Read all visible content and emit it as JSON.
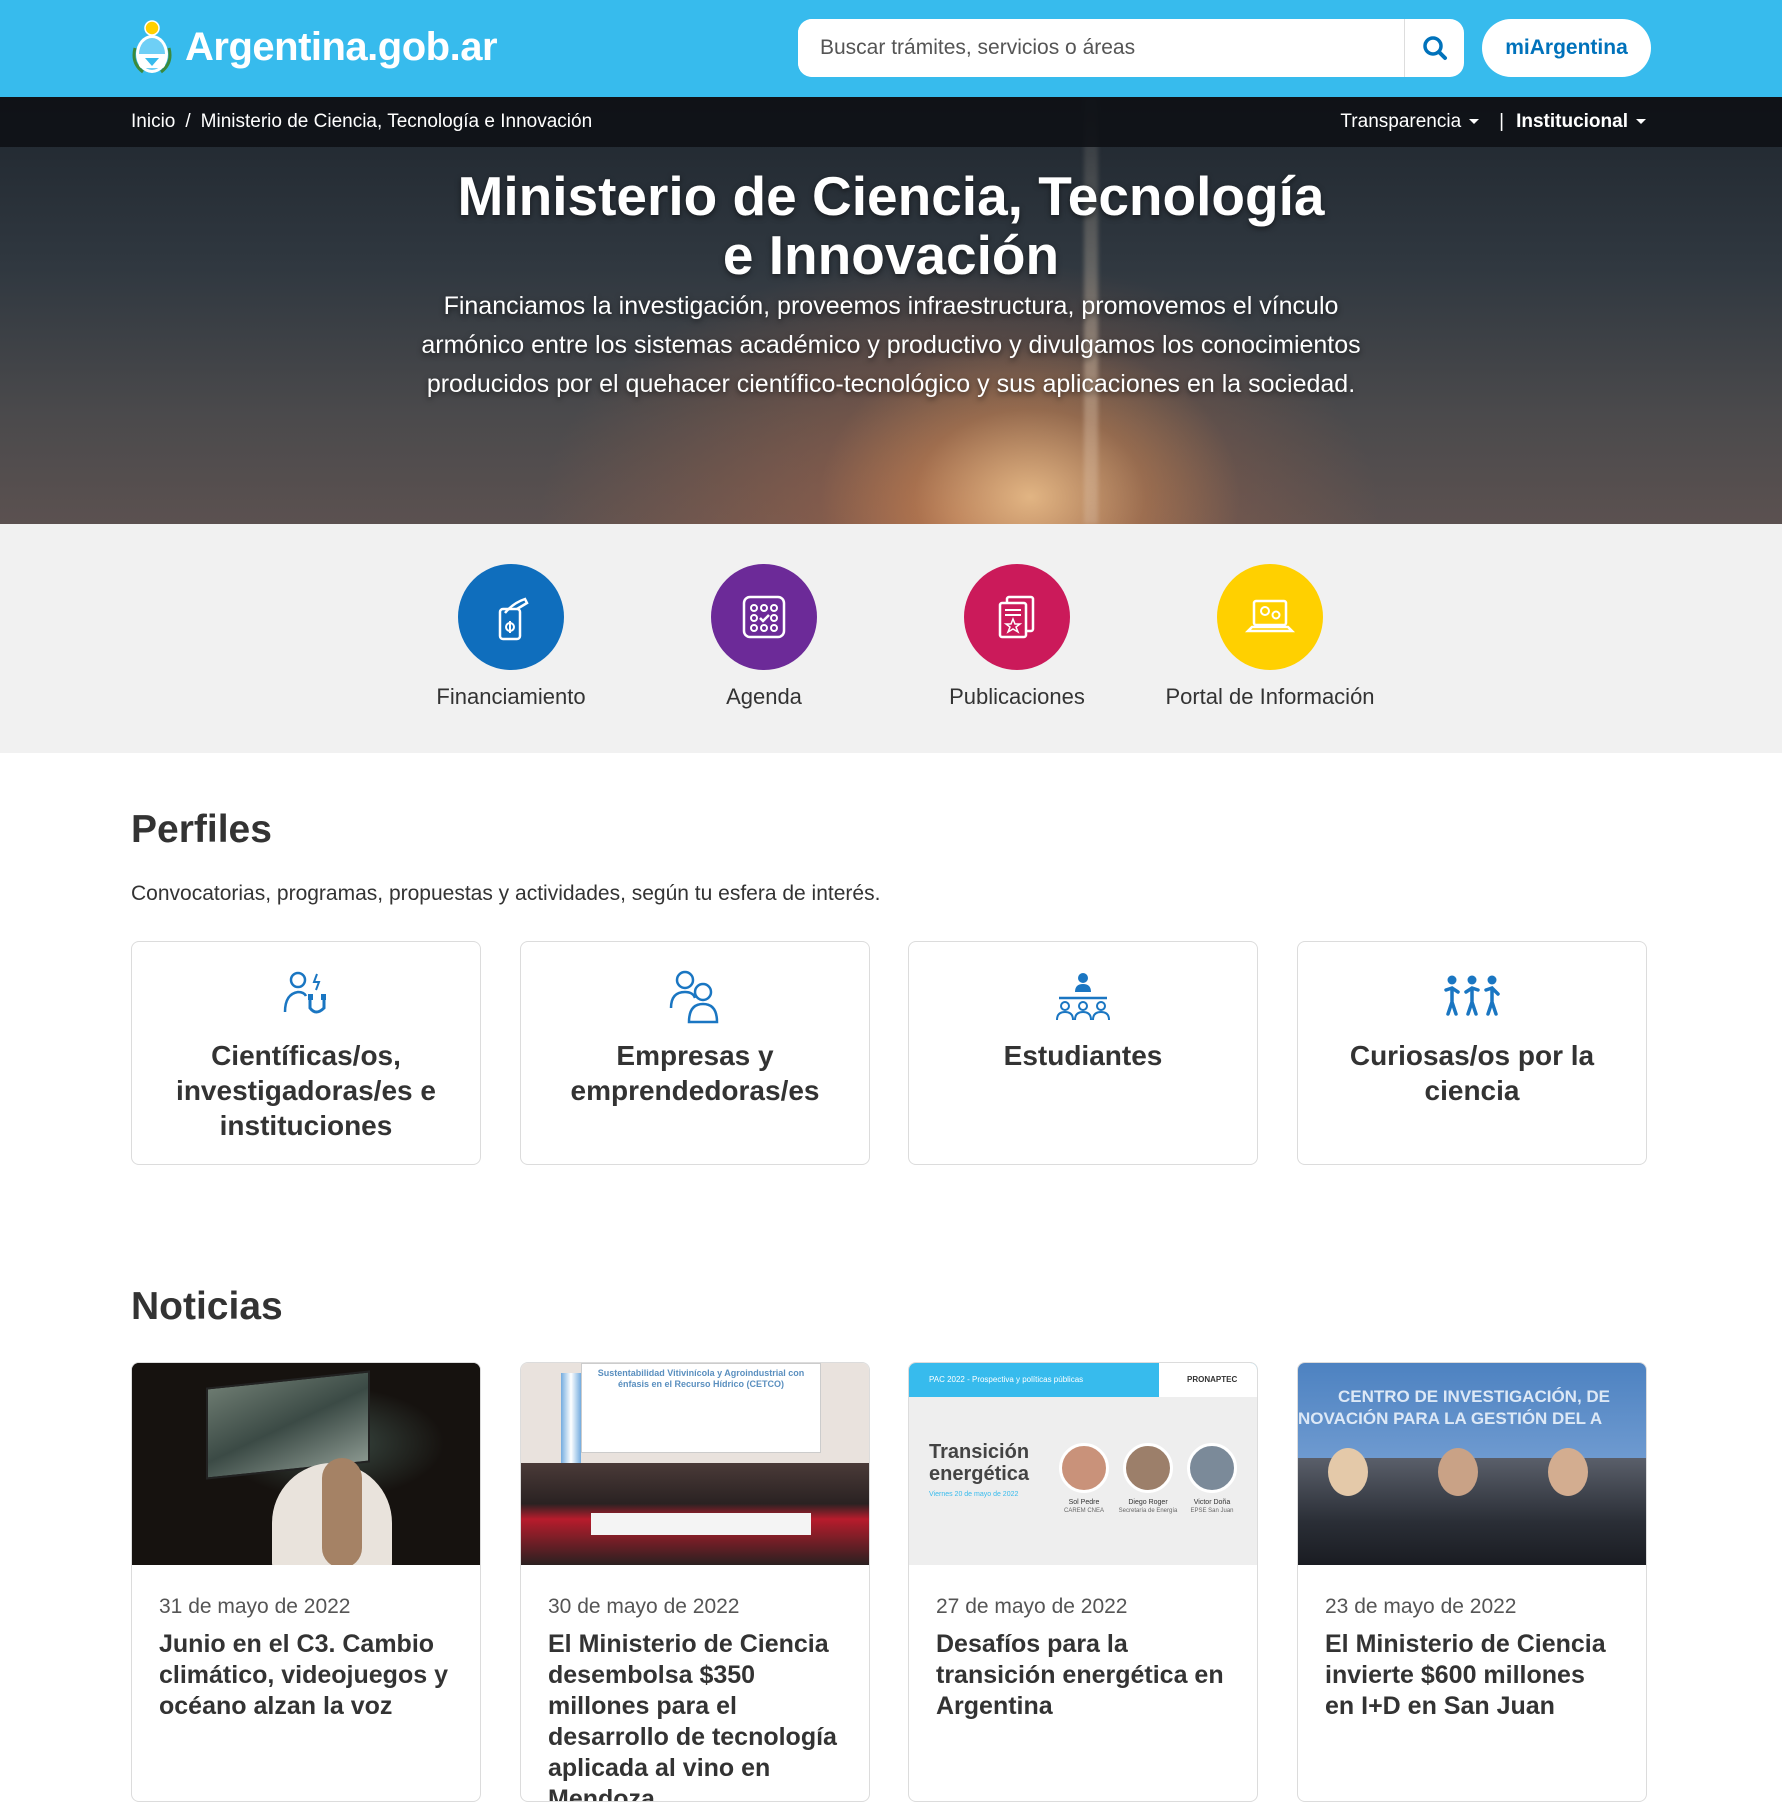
{
  "header": {
    "site_name": "Argentina.gob.ar",
    "search_placeholder": "Buscar trámites, servicios o áreas",
    "account_button": "miArgentina",
    "brand_color": "#37bbed",
    "account_color": "#0072bb"
  },
  "breadcrumb": {
    "home": "Inicio",
    "separator": "/",
    "current": "Ministerio de Ciencia, Tecnología e Innovación"
  },
  "top_nav": {
    "items": [
      {
        "label": "Transparencia"
      },
      {
        "label": "Institucional"
      }
    ],
    "divider": "|"
  },
  "hero": {
    "title": "Ministerio de Ciencia, Tecnología e Innovación",
    "subtitle": "Financiamos la investigación, proveemos infraestructura, promovemos el vínculo armónico entre los sistemas académico y productivo y divulgamos los conocimientos producidos por el quehacer científico-tecnológico y sus aplicaciones en la sociedad."
  },
  "quick_links": [
    {
      "label": "Financiamiento",
      "icon": "hand-phone-icon",
      "color": "#0f6ebd"
    },
    {
      "label": "Agenda",
      "icon": "calendar-grid-icon",
      "color": "#6c2a98"
    },
    {
      "label": "Publicaciones",
      "icon": "documents-icon",
      "color": "#cb1a5a"
    },
    {
      "label": "Portal de Información",
      "icon": "laptop-gears-icon",
      "color": "#ffd000"
    }
  ],
  "perfiles": {
    "title": "Perfiles",
    "lead": "Convocatorias, programas, propuestas y actividades, según tu esfera de interés.",
    "cards": [
      {
        "title": "Científicas/os, investigadoras/es e instituciones",
        "icon": "researcher-magnet-icon"
      },
      {
        "title": "Empresas y emprendedoras/es",
        "icon": "two-people-icon"
      },
      {
        "title": "Estudiantes",
        "icon": "classroom-icon"
      },
      {
        "title": "Curiosas/os por la ciencia",
        "icon": "three-people-icon"
      }
    ],
    "icon_color": "#1a76c2"
  },
  "noticias": {
    "title": "Noticias",
    "items": [
      {
        "date": "31 de mayo de 2022",
        "title": "Junio en el C3. Cambio climático, videojuegos y océano alzan la voz"
      },
      {
        "date": "30 de mayo de 2022",
        "title": "El Ministerio de Ciencia desembolsa $350 millones para el desarrollo de tecnología aplicada al vino en Mendoza",
        "image_text": {
          "banner": "Sustentabilidad Vitivinícola y Agroindustrial con énfasis en el Recurso Hídrico (CETCO)"
        }
      },
      {
        "date": "27 de mayo de 2022",
        "title": "Desafíos para la transición energética en Argentina",
        "image_text": {
          "header": "PAC 2022 - Prospectiva y políticas públicas",
          "brand": "PRONAPTEC",
          "heading": "Transición energética",
          "date": "Viernes 20 de mayo de 2022",
          "speakers": [
            {
              "name": "Sol Pedre",
              "org": "CAREM CNEA"
            },
            {
              "name": "Diego Roger",
              "org": "Secretaría de Energía"
            },
            {
              "name": "Victor Doña",
              "org": "EPSE San Juan"
            }
          ]
        }
      },
      {
        "date": "23 de mayo de 2022",
        "title": "El Ministerio de Ciencia invierte $600 millones en I+D en San Juan",
        "image_text": {
          "banner_line1": "CENTRO DE INVESTIGACIÓN, DE",
          "banner_line2": "NOVACIÓN PARA LA GESTIÓN DEL A"
        }
      }
    ]
  }
}
